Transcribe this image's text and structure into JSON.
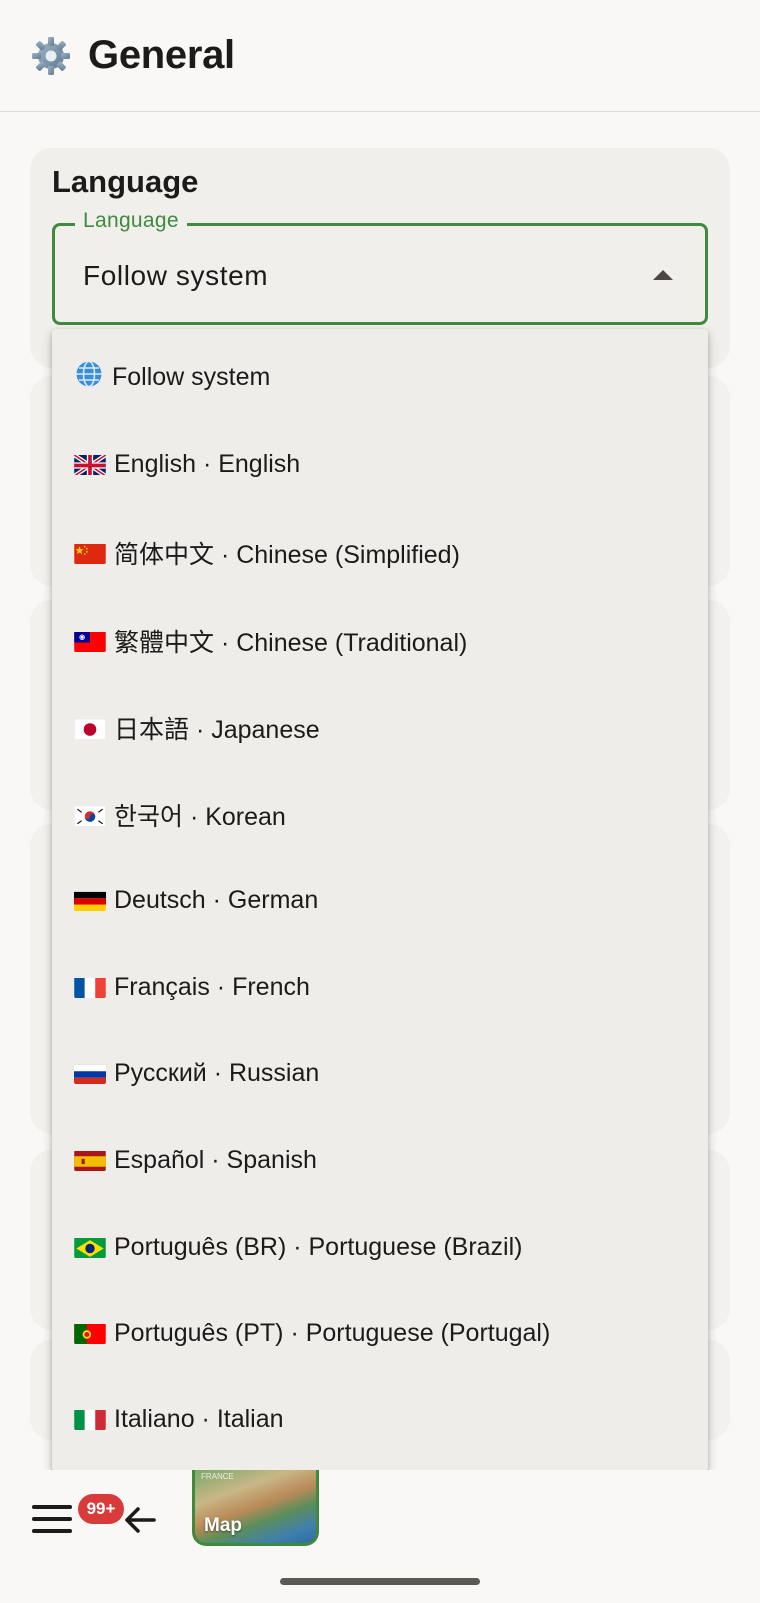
{
  "header": {
    "title": "General",
    "icon": "gear-icon"
  },
  "section": {
    "title": "Language"
  },
  "language_select": {
    "label": "Language",
    "value": "Follow system",
    "accent_color": "#3f8a3c"
  },
  "menu": {
    "items": [
      {
        "icon": "globe-icon",
        "label": "Follow system"
      },
      {
        "icon": "flag-gb-icon",
        "label": "English · English"
      },
      {
        "icon": "flag-cn-icon",
        "label": "简体中文 · Chinese (Simplified)"
      },
      {
        "icon": "flag-tw-icon",
        "label": "繁體中文 · Chinese (Traditional)"
      },
      {
        "icon": "flag-jp-icon",
        "label": "日本語 · Japanese"
      },
      {
        "icon": "flag-kr-icon",
        "label": "한국어 · Korean"
      },
      {
        "icon": "flag-de-icon",
        "label": "Deutsch · German"
      },
      {
        "icon": "flag-fr-icon",
        "label": "Français · French"
      },
      {
        "icon": "flag-ru-icon",
        "label": "Русский · Russian"
      },
      {
        "icon": "flag-es-icon",
        "label": "Español · Spanish"
      },
      {
        "icon": "flag-br-icon",
        "label": "Português (BR) · Portuguese (Brazil)"
      },
      {
        "icon": "flag-pt-icon",
        "label": "Português (PT) · Portuguese (Portugal)"
      },
      {
        "icon": "flag-it-icon",
        "label": "Italiano · Italian"
      }
    ]
  },
  "bottom_bar": {
    "badge": "99+",
    "map_label": "Map",
    "map_small_text": "FRANCE"
  }
}
